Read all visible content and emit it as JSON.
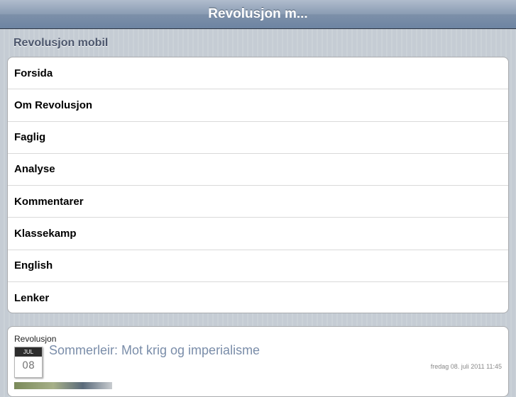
{
  "header": {
    "title": "Revolusjon m..."
  },
  "section": {
    "title": "Revolusjon mobil"
  },
  "menu": {
    "items": [
      {
        "label": "Forsida"
      },
      {
        "label": "Om Revolusjon"
      },
      {
        "label": "Faglig"
      },
      {
        "label": "Analyse"
      },
      {
        "label": "Kommentarer"
      },
      {
        "label": "Klassekamp"
      },
      {
        "label": "English"
      },
      {
        "label": "Lenker"
      }
    ]
  },
  "article": {
    "source": "Revolusjon",
    "month": "JUL",
    "day": "08",
    "title": "Sommerleir: Mot krig og imperialisme",
    "date": "fredag 08. juli 2011 11:45"
  }
}
